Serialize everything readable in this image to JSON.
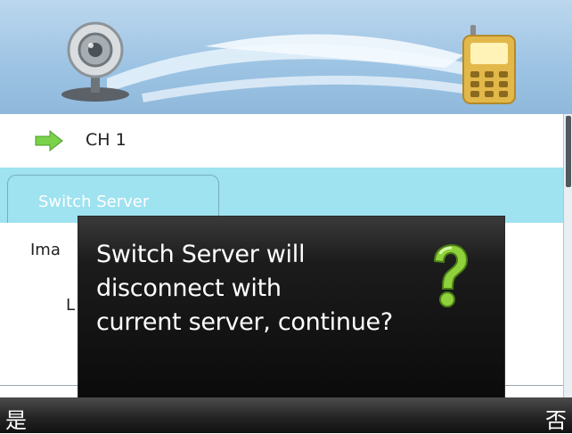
{
  "channel_row": {
    "label": "CH 1"
  },
  "tab": {
    "label": "Switch Server"
  },
  "rows": {
    "image_partial": "Ima",
    "l_partial": "L"
  },
  "dialog": {
    "message": "Switch Server will\ndisconnect with\ncurrent server, continue?"
  },
  "softkeys": {
    "left": "是",
    "right": "否"
  },
  "icons": {
    "header_left": "webcam-icon",
    "header_right": "mobile-phone-icon",
    "row_arrow": "green-arrow-icon",
    "dialog": "question-mark-icon"
  },
  "colors": {
    "tab_highlight": "#9fe2f0",
    "dialog_bg": "#0b0b0b",
    "softbar_bg": "#1a1a1a",
    "arrow_green": "#79d24a",
    "question_green": "#8fd13a"
  }
}
